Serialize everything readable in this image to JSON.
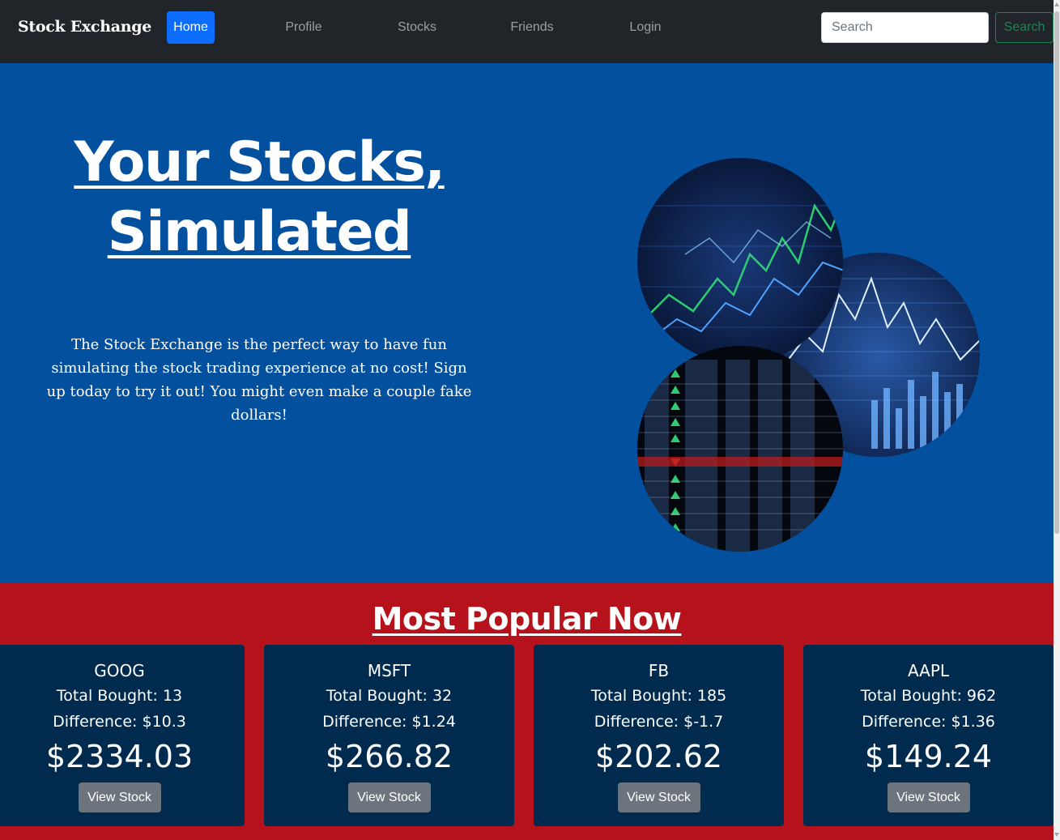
{
  "navbar": {
    "brand": "Stock Exchange",
    "links": [
      {
        "label": "Home",
        "active": true
      },
      {
        "label": "Profile",
        "active": false
      },
      {
        "label": "Stocks",
        "active": false
      },
      {
        "label": "Friends",
        "active": false
      },
      {
        "label": "Login",
        "active": false
      }
    ],
    "search": {
      "placeholder": "Search",
      "value": "",
      "button_label": "Search"
    }
  },
  "hero": {
    "title": "Your Stocks, Simulated",
    "description": "The Stock Exchange is the perfect way to have fun simulating the stock trading experience at no cost! Sign up today to try it out! You might even make a couple fake dollars!",
    "image": "stock-market-charts-collage"
  },
  "popular": {
    "title": "Most Popular Now",
    "stocks": [
      {
        "ticker": "GOOG",
        "bought": "Total Bought: 13",
        "difference": "Difference: $10.3",
        "price": "$2334.03",
        "button": "View Stock"
      },
      {
        "ticker": "MSFT",
        "bought": "Total Bought: 32",
        "difference": "Difference: $1.24",
        "price": "$266.82",
        "button": "View Stock"
      },
      {
        "ticker": "FB",
        "bought": "Total Bought: 185",
        "difference": "Difference: $-1.7",
        "price": "$202.62",
        "button": "View Stock"
      },
      {
        "ticker": "AAPL",
        "bought": "Total Bought: 962",
        "difference": "Difference: $1.36",
        "price": "$149.24",
        "button": "View Stock"
      }
    ]
  },
  "colors": {
    "navbar": "#212529",
    "hero": "#03509e",
    "popular": "#b5121b",
    "card": "#002b4f",
    "primary": "#0d6efd",
    "success": "#198754",
    "secondary": "#6c757d"
  }
}
